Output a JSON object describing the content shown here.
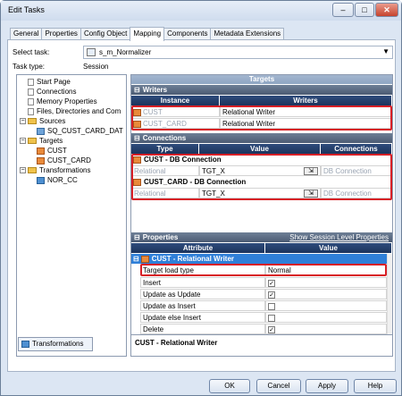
{
  "window": {
    "title": "Edit Tasks",
    "minimize": "–",
    "maximize": "□",
    "close": "✕"
  },
  "tabs": [
    "General",
    "Properties",
    "Config Object",
    "Mapping",
    "Components",
    "Metadata Extensions"
  ],
  "active_tab": "Mapping",
  "select_task": {
    "label": "Select task:",
    "value": "s_m_Normalizer"
  },
  "task_type": {
    "label": "Task type:",
    "value": "Session"
  },
  "tree": {
    "items": [
      {
        "label": "Start Page",
        "icon": "doc-icon",
        "indent": 0
      },
      {
        "label": "Connections",
        "icon": "doc-icon",
        "indent": 0
      },
      {
        "label": "Memory Properties",
        "icon": "doc-icon",
        "indent": 0
      },
      {
        "label": "Files, Directories and Com",
        "icon": "doc-icon",
        "indent": 0
      },
      {
        "label": "Sources",
        "icon": "folder-icon",
        "indent": 0,
        "expander": "−"
      },
      {
        "label": "SQ_CUST_CARD_DAT",
        "icon": "source-qualifier-icon",
        "indent": 1
      },
      {
        "label": "Targets",
        "icon": "folder-icon",
        "indent": 0,
        "expander": "−"
      },
      {
        "label": "CUST",
        "icon": "target-icon",
        "indent": 1
      },
      {
        "label": "CUST_CARD",
        "icon": "target-icon",
        "indent": 1
      },
      {
        "label": "Transformations",
        "icon": "folder-icon",
        "indent": 0,
        "expander": "−"
      },
      {
        "label": "NOR_CC",
        "icon": "normalizer-icon",
        "indent": 1
      }
    ],
    "bottom_tab": "Transformations"
  },
  "targets_header": "Targets",
  "writers": {
    "section": "Writers",
    "col_instance": "Instance",
    "col_writers": "Writers",
    "rows": [
      {
        "instance": "CUST",
        "writer": "Relational Writer"
      },
      {
        "instance": "CUST_CARD",
        "writer": "Relational Writer"
      }
    ]
  },
  "connections": {
    "section": "Connections",
    "col_type": "Type",
    "col_value": "Value",
    "col_connections": "Connections",
    "groups": [
      {
        "title": "CUST - DB Connection",
        "type": "Relational",
        "value": "TGT_X",
        "connection": "DB Connection"
      },
      {
        "title": "CUST_CARD - DB Connection",
        "type": "Relational",
        "value": "TGT_X",
        "connection": "DB Connection"
      }
    ]
  },
  "properties": {
    "section": "Properties",
    "session_link": "Show Session Level Properties",
    "col_attribute": "Attribute",
    "col_value": "Value",
    "group": "CUST - Relational Writer",
    "rows": [
      {
        "attr": "Target load type",
        "value": "Normal",
        "checkbox": false
      },
      {
        "attr": "Insert",
        "value": "✓",
        "checkbox": true
      },
      {
        "attr": "Update as Update",
        "value": "✓",
        "checkbox": true
      },
      {
        "attr": "Update as Insert",
        "value": "",
        "checkbox": true
      },
      {
        "attr": "Update else Insert",
        "value": "",
        "checkbox": true
      },
      {
        "attr": "Delete",
        "value": "✓",
        "checkbox": true
      }
    ],
    "status": "CUST - Relational Writer"
  },
  "buttons": {
    "ok": "OK",
    "cancel": "Cancel",
    "apply": "Apply",
    "help": "Help"
  },
  "colors": {
    "accent": "#1c335b",
    "highlight": "#d81f26",
    "group_bar": "#2f7fd8"
  }
}
